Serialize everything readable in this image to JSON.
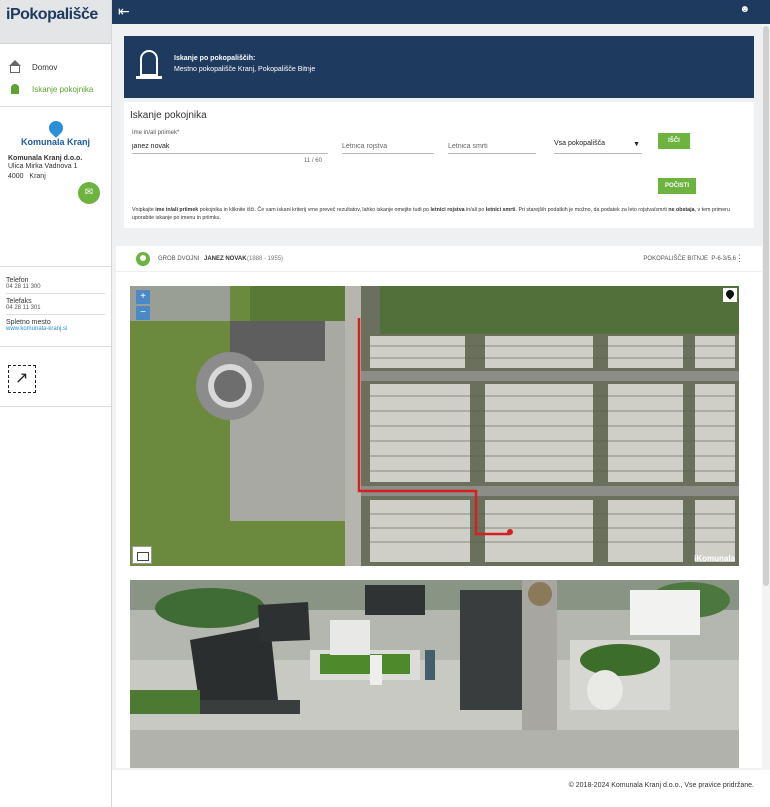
{
  "app": {
    "logo": "iPokopališče"
  },
  "sidebar": {
    "nav": [
      {
        "label": "Domov",
        "icon": "home-icon"
      },
      {
        "label": "Iskanje pokojnika",
        "icon": "grave-icon"
      }
    ],
    "company": {
      "logo_text": "Komunala Kranj",
      "name": "Komunala Kranj d.o.o.",
      "street": "Ulica Mirka Vadnova 1",
      "city": "4000   Kranj"
    },
    "contacts": [
      {
        "label": "Telefon",
        "value": "04 28 11 300"
      },
      {
        "label": "Telefaks",
        "value": "04 28 11 301"
      },
      {
        "label": "Spletno mesto",
        "value": "www.komunala-kranj.si"
      }
    ]
  },
  "banner": {
    "title": "Iskanje po pokopališčih:",
    "subtitle": "Mestno pokopališče Kranj, Pokopališče Bitnje"
  },
  "search": {
    "heading": "Iskanje pokojnika",
    "name_label": "Ime in/ali priimek*",
    "name_value": "janez novak",
    "char_count": "11 / 60",
    "birth_placeholder": "Letnica rojstva",
    "death_placeholder": "Letnica smrti",
    "cemetery_selected": "Vsa pokopališča",
    "search_button": "IŠČI",
    "clear_button": "POČISTI",
    "help": {
      "p1": "Vnipkajte ",
      "b1": "ime in/ali priimek",
      "p2": " pokojnika in kliknite išči. Če vam iskani kriterij vrne preveč rezultatov, lahko iskanje omejite tudi po ",
      "b2": "letnici rojstva",
      "p3": " in/ali po ",
      "b3": "letnici smrti",
      "p4": ". Pri starejših podatkih je možno, da podatek za leto rojstva/smrti ",
      "b4": "ne obstaja",
      "p5": ", v tem primeru uporabite iskanje po imenu in priimku."
    }
  },
  "result": {
    "type": "GROB DVOJNI",
    "name": "JANEZ NOVAK",
    "years": "(1888 - 1955)",
    "cemetery": "POKOPALIŠČE BITNJE",
    "position": "P-6-3/5,6",
    "map_watermark": "iKomunala",
    "zoom_in": "+",
    "zoom_out": "−"
  },
  "footer": {
    "text": "© 2018-2024  Komunala Kranj d.o.o., Vse pravice pridržane."
  },
  "colors": {
    "navy": "#1e3a5f",
    "green": "#6cb33f",
    "link": "#2a8fd6",
    "route": "#d42020"
  }
}
